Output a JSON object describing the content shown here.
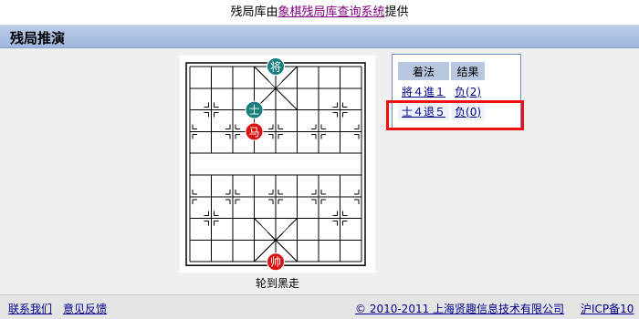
{
  "header": {
    "prefix": "残局库由",
    "link_text": "象棋残局库查询系统",
    "suffix": "提供"
  },
  "title_bar": {
    "title": "残局推演"
  },
  "board": {
    "pieces": [
      {
        "label": "将",
        "side": "black",
        "file": 4,
        "rank": 0
      },
      {
        "label": "士",
        "side": "black",
        "file": 3,
        "rank": 2
      },
      {
        "label": "马",
        "side": "red",
        "file": 3,
        "rank": 3
      },
      {
        "label": "帅",
        "side": "red",
        "file": 4,
        "rank": 9
      }
    ],
    "colors": {
      "red": "#dd1111",
      "black": "#1a7f7f",
      "lines": "#000000"
    }
  },
  "turn_text": "轮到黑走",
  "moves_table": {
    "headers": [
      "着法",
      "结果"
    ],
    "rows": [
      {
        "move": "將４進１",
        "result": "负(2)"
      },
      {
        "move": "士４退５",
        "result": "负(0)"
      }
    ]
  },
  "footer": {
    "contact": "联系我们",
    "feedback": "意见反馈",
    "copyright": "© 2010-2011 上海贤趣信息技术有限公司",
    "icp": "沪ICP备10"
  }
}
